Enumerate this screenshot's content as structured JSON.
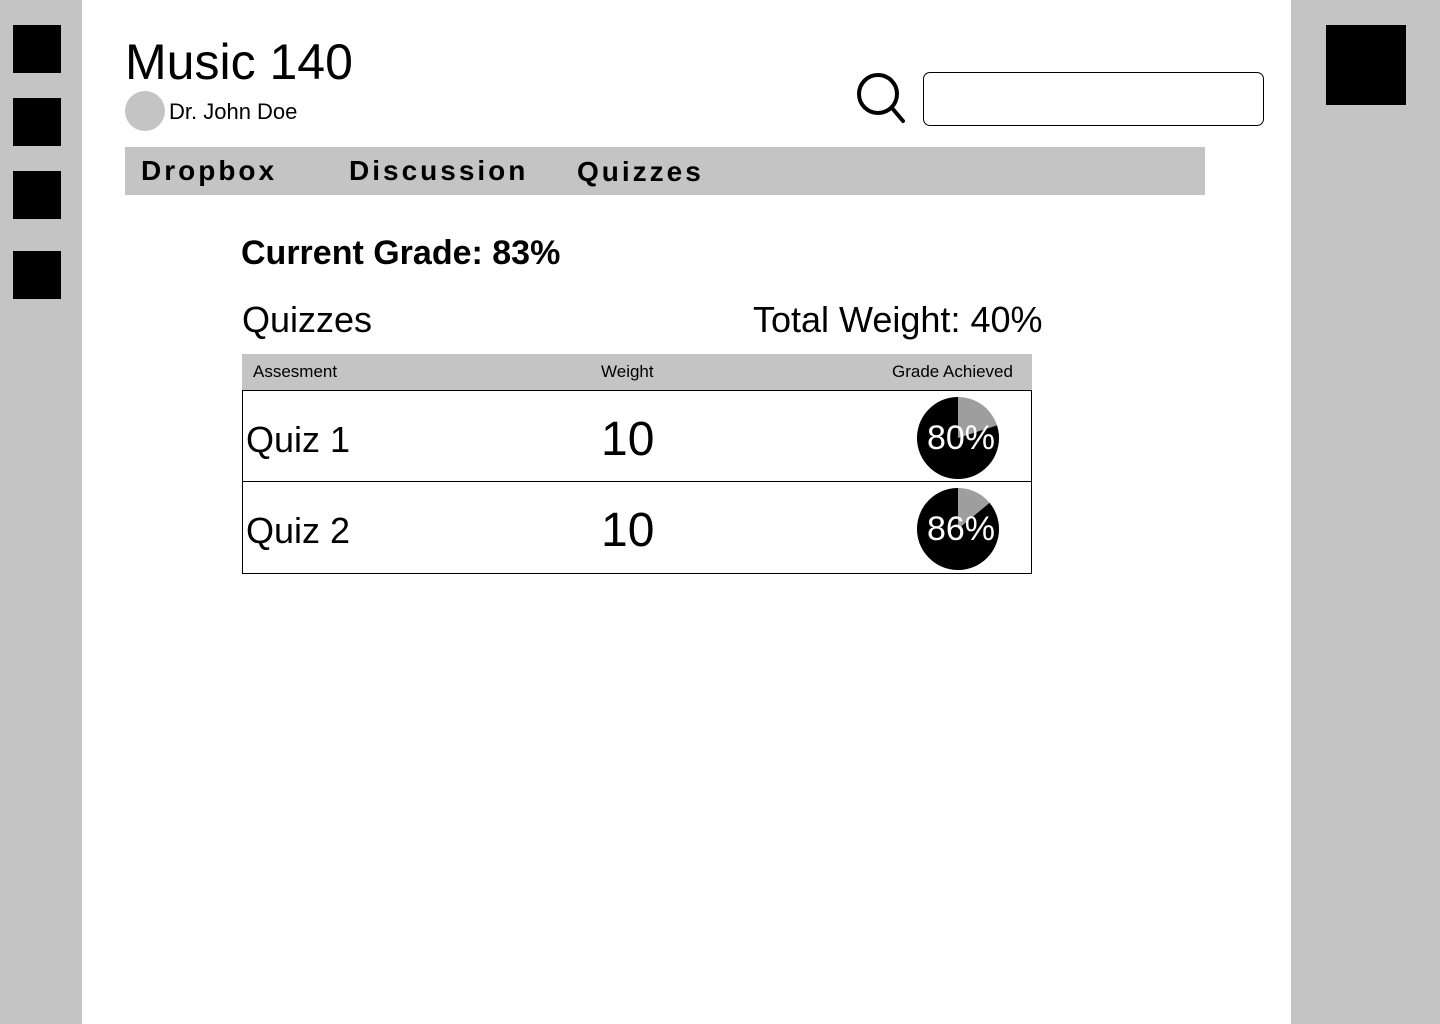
{
  "course": {
    "title": "Music 140",
    "instructor": "Dr. John Doe"
  },
  "search": {
    "placeholder": "",
    "value": ""
  },
  "tabs": [
    {
      "label": "Dropbox"
    },
    {
      "label": "Discussion"
    },
    {
      "label": "Quizzes"
    }
  ],
  "grades": {
    "current_grade": "Current Grade: 83%",
    "section_title": "Quizzes",
    "total_weight": "Total Weight: 40%",
    "headers": {
      "assessment": "Assesment",
      "weight": "Weight",
      "grade": "Grade Achieved"
    },
    "rows": [
      {
        "name": "Quiz 1",
        "weight": "10",
        "grade_label": "80%",
        "grade_value": 80
      },
      {
        "name": "Quiz 2",
        "weight": "10",
        "grade_label": "86%",
        "grade_value": 86
      }
    ]
  },
  "colors": {
    "rail": "#c4c4c4",
    "pie_filled": "#000000",
    "pie_remaining": "#9e9e9e"
  }
}
